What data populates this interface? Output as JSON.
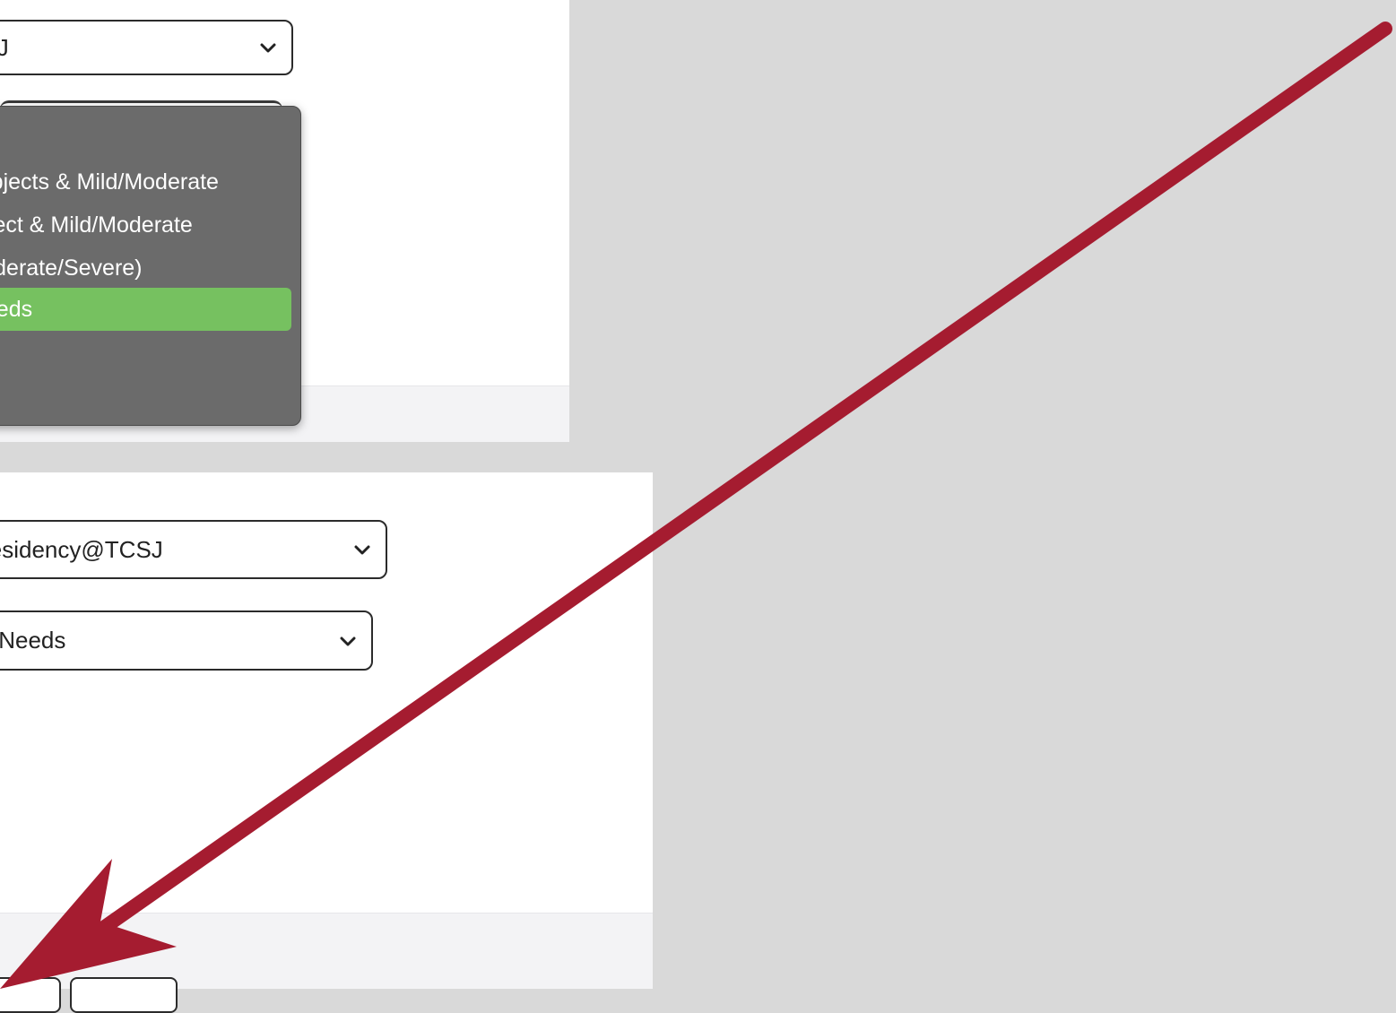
{
  "top_panel": {
    "program_select": {
      "value": "Residency@TCSJ"
    },
    "dropdown": {
      "options": [
        {
          "label": "Multiple Subjects & Mild/Moderate",
          "selected": false
        },
        {
          "label": "Single Subject & Mild/Moderate",
          "selected": false
        },
        {
          "label": "Education Specialist (Moderate/Severe)",
          "selected": false
        },
        {
          "label": "Extensive Support Needs",
          "selected": true
        }
      ]
    }
  },
  "bottom_panel": {
    "program_select": {
      "value": "Residency@TCSJ"
    },
    "credential_select": {
      "value": "Extensive Support Needs"
    },
    "buttons": []
  },
  "annotation": {
    "arrow_color": "#a51c30"
  }
}
